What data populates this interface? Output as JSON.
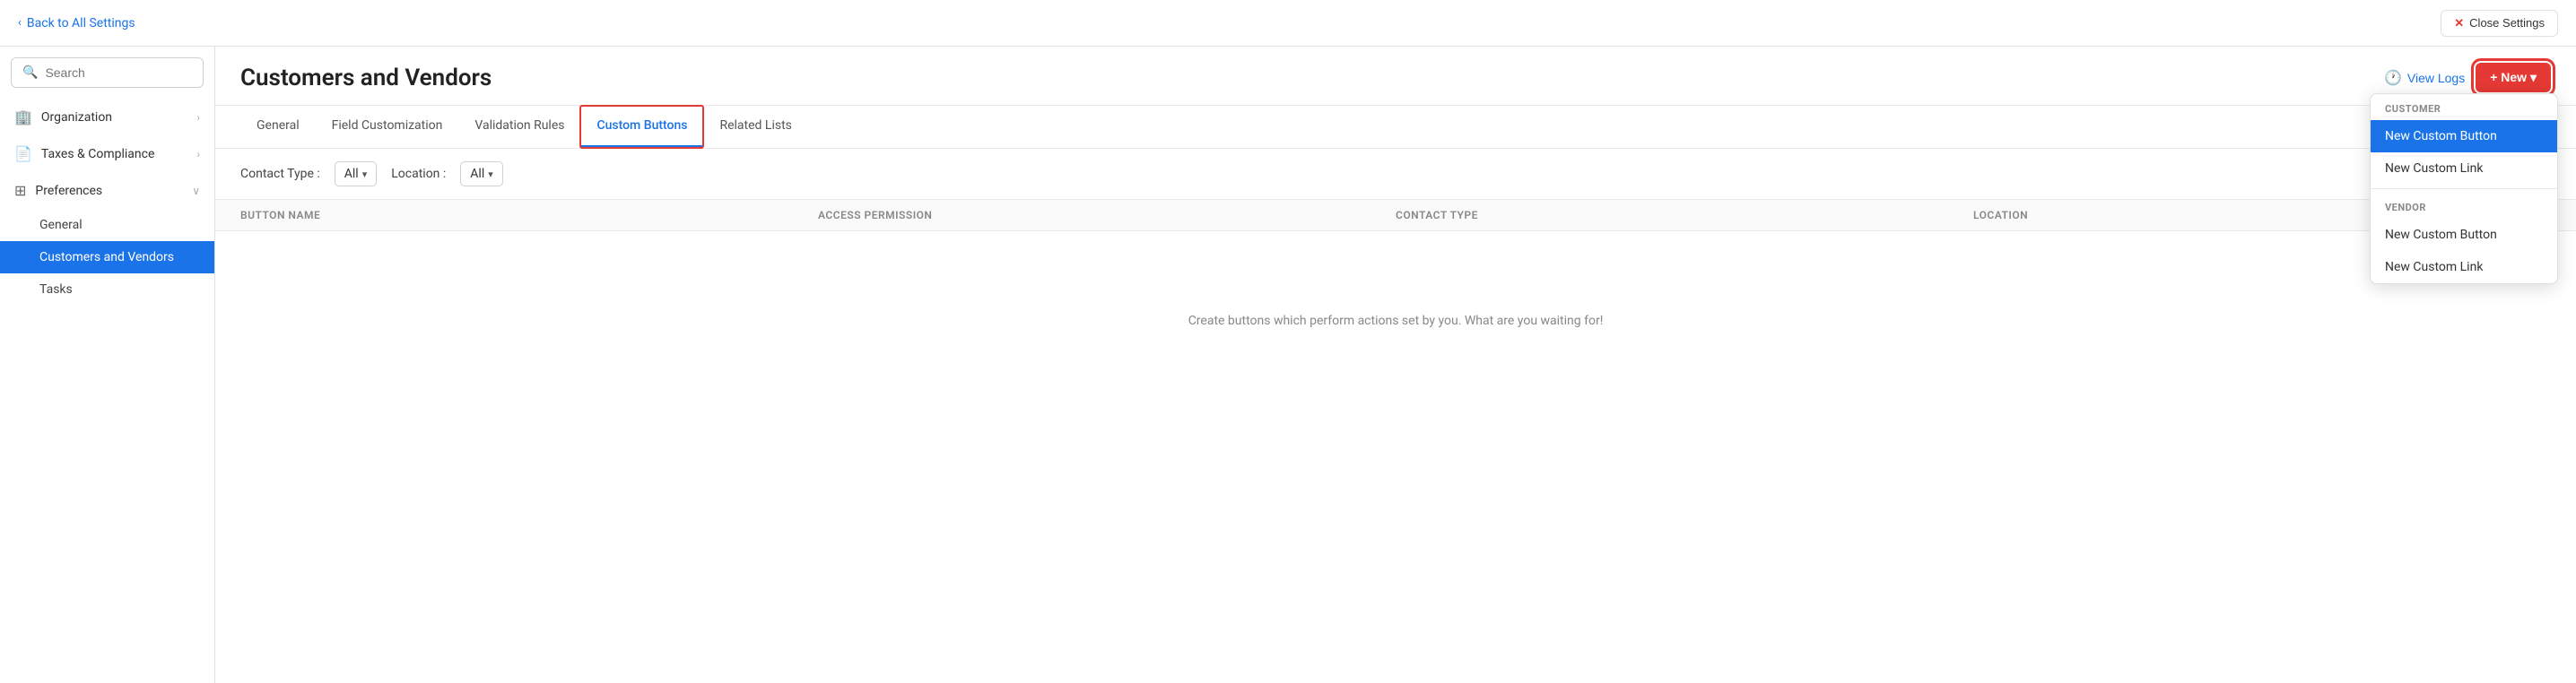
{
  "topBar": {
    "backLabel": "Back to All Settings",
    "closeLabel": "Close Settings"
  },
  "sidebar": {
    "searchPlaceholder": "Search",
    "items": [
      {
        "id": "organization",
        "label": "Organization",
        "icon": "🏢",
        "hasChildren": true,
        "expanded": false
      },
      {
        "id": "taxes",
        "label": "Taxes & Compliance",
        "icon": "📄",
        "hasChildren": true,
        "expanded": false
      },
      {
        "id": "preferences",
        "label": "Preferences",
        "icon": "⊞",
        "hasChildren": true,
        "expanded": true
      },
      {
        "id": "customers-vendors",
        "label": "Customers and Vendors",
        "icon": "",
        "isSubItem": true,
        "active": true
      },
      {
        "id": "general-sub",
        "label": "General",
        "icon": "",
        "isSubItem": true,
        "active": false
      },
      {
        "id": "tasks",
        "label": "Tasks",
        "icon": "",
        "isSubItem": true,
        "active": false
      }
    ]
  },
  "content": {
    "pageTitle": "Customers and Vendors",
    "viewLogsLabel": "View Logs",
    "newButtonLabel": "+ New ▾",
    "tabs": [
      {
        "id": "general",
        "label": "General",
        "active": false
      },
      {
        "id": "field-customization",
        "label": "Field Customization",
        "active": false
      },
      {
        "id": "validation-rules",
        "label": "Validation Rules",
        "active": false
      },
      {
        "id": "custom-buttons",
        "label": "Custom Buttons",
        "active": true
      },
      {
        "id": "related-lists",
        "label": "Related Lists",
        "active": false
      }
    ],
    "filters": {
      "contactTypeLabel": "Contact Type :",
      "contactTypeValue": "All",
      "locationLabel": "Location :",
      "locationValue": "All"
    },
    "table": {
      "columns": [
        "Button Name",
        "Access Permission",
        "Contact Type",
        "Location"
      ]
    },
    "emptyStateText": "Create buttons which perform actions set by you. What are you waiting for!"
  },
  "dropdown": {
    "customerSectionLabel": "Customer",
    "vendorSectionLabel": "Vendor",
    "items": [
      {
        "id": "customer-new-button",
        "label": "New Custom Button",
        "section": "customer",
        "highlighted": true
      },
      {
        "id": "customer-new-link",
        "label": "New Custom Link",
        "section": "customer",
        "highlighted": false
      },
      {
        "id": "vendor-new-button",
        "label": "New Custom Button",
        "section": "vendor",
        "highlighted": false
      },
      {
        "id": "vendor-new-link",
        "label": "New Custom Link",
        "section": "vendor",
        "highlighted": false
      }
    ]
  }
}
